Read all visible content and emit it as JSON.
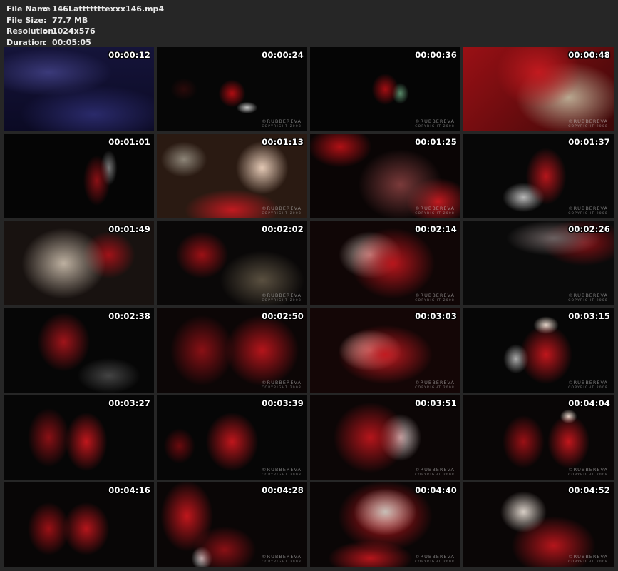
{
  "info": {
    "file_name_label": "File Name",
    "file_name": "146Latttttttexxx146.mp4",
    "file_size_label": "File Size",
    "file_size": "77.7 MB",
    "resolution_label": "Resolution",
    "resolution": "1024x576",
    "duration_label": "Duration",
    "duration": "00:05:05",
    "separator": ":"
  },
  "watermark": {
    "brand": "©RUBBEREVA",
    "copyright": "COPYRIGHT 2008"
  },
  "thumbnails": [
    {
      "timestamp": "00:00:12"
    },
    {
      "timestamp": "00:00:24"
    },
    {
      "timestamp": "00:00:36"
    },
    {
      "timestamp": "00:00:48"
    },
    {
      "timestamp": "00:01:01"
    },
    {
      "timestamp": "00:01:13"
    },
    {
      "timestamp": "00:01:25"
    },
    {
      "timestamp": "00:01:37"
    },
    {
      "timestamp": "00:01:49"
    },
    {
      "timestamp": "00:02:02"
    },
    {
      "timestamp": "00:02:14"
    },
    {
      "timestamp": "00:02:26"
    },
    {
      "timestamp": "00:02:38"
    },
    {
      "timestamp": "00:02:50"
    },
    {
      "timestamp": "00:03:03"
    },
    {
      "timestamp": "00:03:15"
    },
    {
      "timestamp": "00:03:27"
    },
    {
      "timestamp": "00:03:39"
    },
    {
      "timestamp": "00:03:51"
    },
    {
      "timestamp": "00:04:04"
    },
    {
      "timestamp": "00:04:16"
    },
    {
      "timestamp": "00:04:28"
    },
    {
      "timestamp": "00:04:40"
    },
    {
      "timestamp": "00:04:52"
    }
  ]
}
